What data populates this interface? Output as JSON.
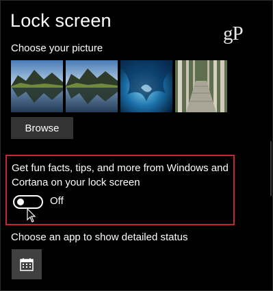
{
  "page": {
    "title": "Lock screen",
    "watermark": "gP"
  },
  "picture_section": {
    "heading": "Choose your picture",
    "thumbnails": [
      {
        "icon": "mountain-lake-image"
      },
      {
        "icon": "mountain-lake-image"
      },
      {
        "icon": "ice-cave-image"
      },
      {
        "icon": "forest-boardwalk-image"
      }
    ],
    "browse_label": "Browse"
  },
  "fun_facts": {
    "description": "Get fun facts, tips, and more from Windows and Cortana on your lock screen",
    "toggle_state": "Off",
    "highlight_color": "#c6262e"
  },
  "detailed_status": {
    "heading": "Choose an app to show detailed status",
    "app_icon": "calendar-icon"
  }
}
